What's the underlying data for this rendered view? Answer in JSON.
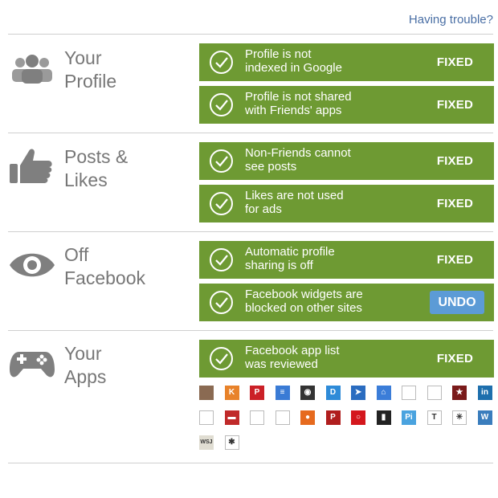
{
  "help_link": "Having trouble?",
  "sections": [
    {
      "title": "Your\nProfile",
      "icon": "people-icon",
      "items": [
        {
          "text": "Profile is not\nindexed in Google",
          "status": "FIXED"
        },
        {
          "text": "Profile is not shared\nwith Friends' apps",
          "status": "FIXED"
        }
      ]
    },
    {
      "title": "Posts &\nLikes",
      "icon": "thumbs-up-icon",
      "items": [
        {
          "text": "Non-Friends cannot\nsee posts",
          "status": "FIXED"
        },
        {
          "text": "Likes are not used\nfor ads",
          "status": "FIXED"
        }
      ]
    },
    {
      "title": "Off\nFacebook",
      "icon": "eye-icon",
      "items": [
        {
          "text": "Automatic profile\nsharing is off",
          "status": "FIXED"
        },
        {
          "text": "Facebook widgets are\nblocked on other sites",
          "status": "UNDO"
        }
      ]
    },
    {
      "title": "Your\nApps",
      "icon": "gamepad-icon",
      "items": [
        {
          "text": "Facebook app list\nwas reviewed",
          "status": "FIXED"
        }
      ]
    }
  ],
  "apps": [
    {
      "name": "instagram-app-icon",
      "color": "#8a6a52",
      "label": ""
    },
    {
      "name": "klout-app-icon",
      "color": "#e8822a",
      "label": "K"
    },
    {
      "name": "pinterest-app-icon",
      "color": "#cb2027",
      "label": "P"
    },
    {
      "name": "buffer-app-icon",
      "color": "#3a7bd5",
      "label": "≡"
    },
    {
      "name": "camera-app-icon",
      "color": "#333333",
      "label": "◉"
    },
    {
      "name": "d-app-icon",
      "color": "#2e8bd8",
      "label": "D"
    },
    {
      "name": "send-app-icon",
      "color": "#2a6cc0",
      "label": "➤"
    },
    {
      "name": "house-app-icon",
      "color": "#3b7dd8",
      "label": "⌂"
    },
    {
      "name": "blank-app-icon-1",
      "color": "#ffffff",
      "label": ""
    },
    {
      "name": "flag-app-icon",
      "color": "#ffffff",
      "label": ""
    },
    {
      "name": "star-app-icon",
      "color": "#7a1a1a",
      "label": "★"
    },
    {
      "name": "linkedin-app-icon",
      "color": "#1e6fad",
      "label": "in"
    },
    {
      "name": "blank-app-icon-2",
      "color": "#ffffff",
      "label": ""
    },
    {
      "name": "red-app-icon",
      "color": "#c02a2a",
      "label": "▬"
    },
    {
      "name": "blank-app-icon-3",
      "color": "#ffffff",
      "label": ""
    },
    {
      "name": "blank-app-icon-4",
      "color": "#ffffff",
      "label": ""
    },
    {
      "name": "orange-circle-app-icon",
      "color": "#e66a1e",
      "label": "●"
    },
    {
      "name": "pinterest-app-icon-2",
      "color": "#b01e1e",
      "label": "P"
    },
    {
      "name": "ring-app-icon",
      "color": "#d4171d",
      "label": "○"
    },
    {
      "name": "bars-app-icon",
      "color": "#222222",
      "label": "▮"
    },
    {
      "name": "pi-app-icon",
      "color": "#4aa3df",
      "label": "Pi"
    },
    {
      "name": "nytimes-app-icon",
      "color": "#ffffff",
      "label": "T"
    },
    {
      "name": "sparkle-app-icon",
      "color": "#ffffff",
      "label": "✳"
    },
    {
      "name": "wordpress-app-icon",
      "color": "#3a7dbd",
      "label": "W"
    },
    {
      "name": "wsj-app-icon",
      "color": "#e0ddd2",
      "label": "WSJ"
    },
    {
      "name": "yelp-app-icon",
      "color": "#ffffff",
      "label": "✱"
    }
  ]
}
